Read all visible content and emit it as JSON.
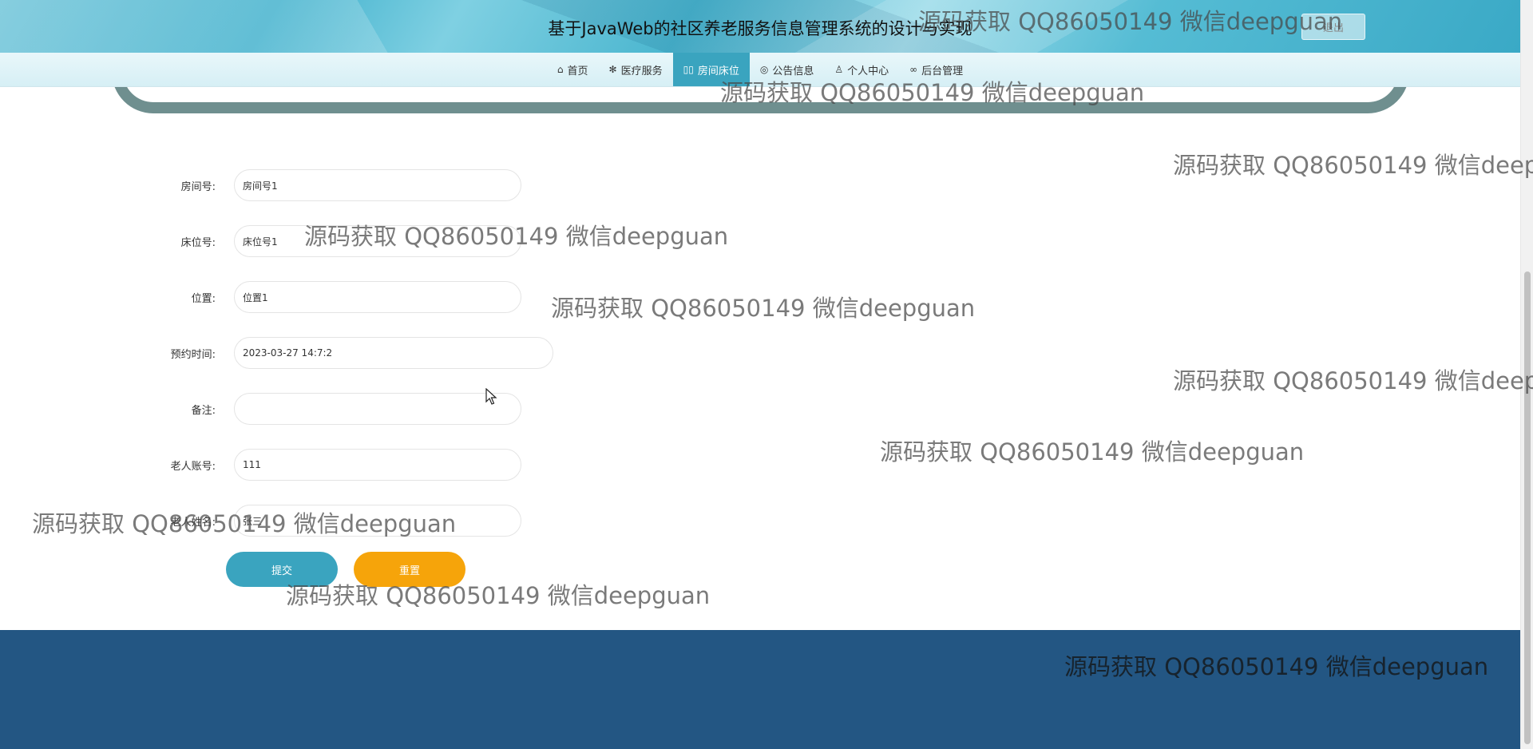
{
  "header": {
    "title": "基于JavaWeb的社区养老服务信息管理系统的设计与实现",
    "logout_label": "退出"
  },
  "nav": {
    "items": [
      {
        "label": "首页",
        "icon": "home-icon",
        "glyph": "⌂",
        "active": false
      },
      {
        "label": "医疗服务",
        "icon": "snowflake-icon",
        "glyph": "✻",
        "active": false
      },
      {
        "label": "房间床位",
        "icon": "columns-icon",
        "glyph": "▯▯",
        "active": true
      },
      {
        "label": "公告信息",
        "icon": "palette-icon",
        "glyph": "◎",
        "active": false
      },
      {
        "label": "个人中心",
        "icon": "user-icon",
        "glyph": "♙",
        "active": false
      },
      {
        "label": "后台管理",
        "icon": "link-icon",
        "glyph": "∞",
        "active": false
      }
    ]
  },
  "form": {
    "fields": [
      {
        "label": "房间号:",
        "value": "房间号1"
      },
      {
        "label": "床位号:",
        "value": "床位号1"
      },
      {
        "label": "位置:",
        "value": "位置1"
      },
      {
        "label": "预约时间:",
        "value": "2023-03-27 14:7:2"
      },
      {
        "label": "备注:",
        "value": ""
      },
      {
        "label": "老人账号:",
        "value": "111"
      },
      {
        "label": "老人姓名:",
        "value": "张三"
      }
    ],
    "submit_label": "提交",
    "reset_label": "重置"
  },
  "watermark": {
    "text": "源码获取 QQ86050149 微信deepguan"
  },
  "colors": {
    "primary": "#3aa4bf",
    "reset": "#f6a40a",
    "footer": "#235683"
  }
}
